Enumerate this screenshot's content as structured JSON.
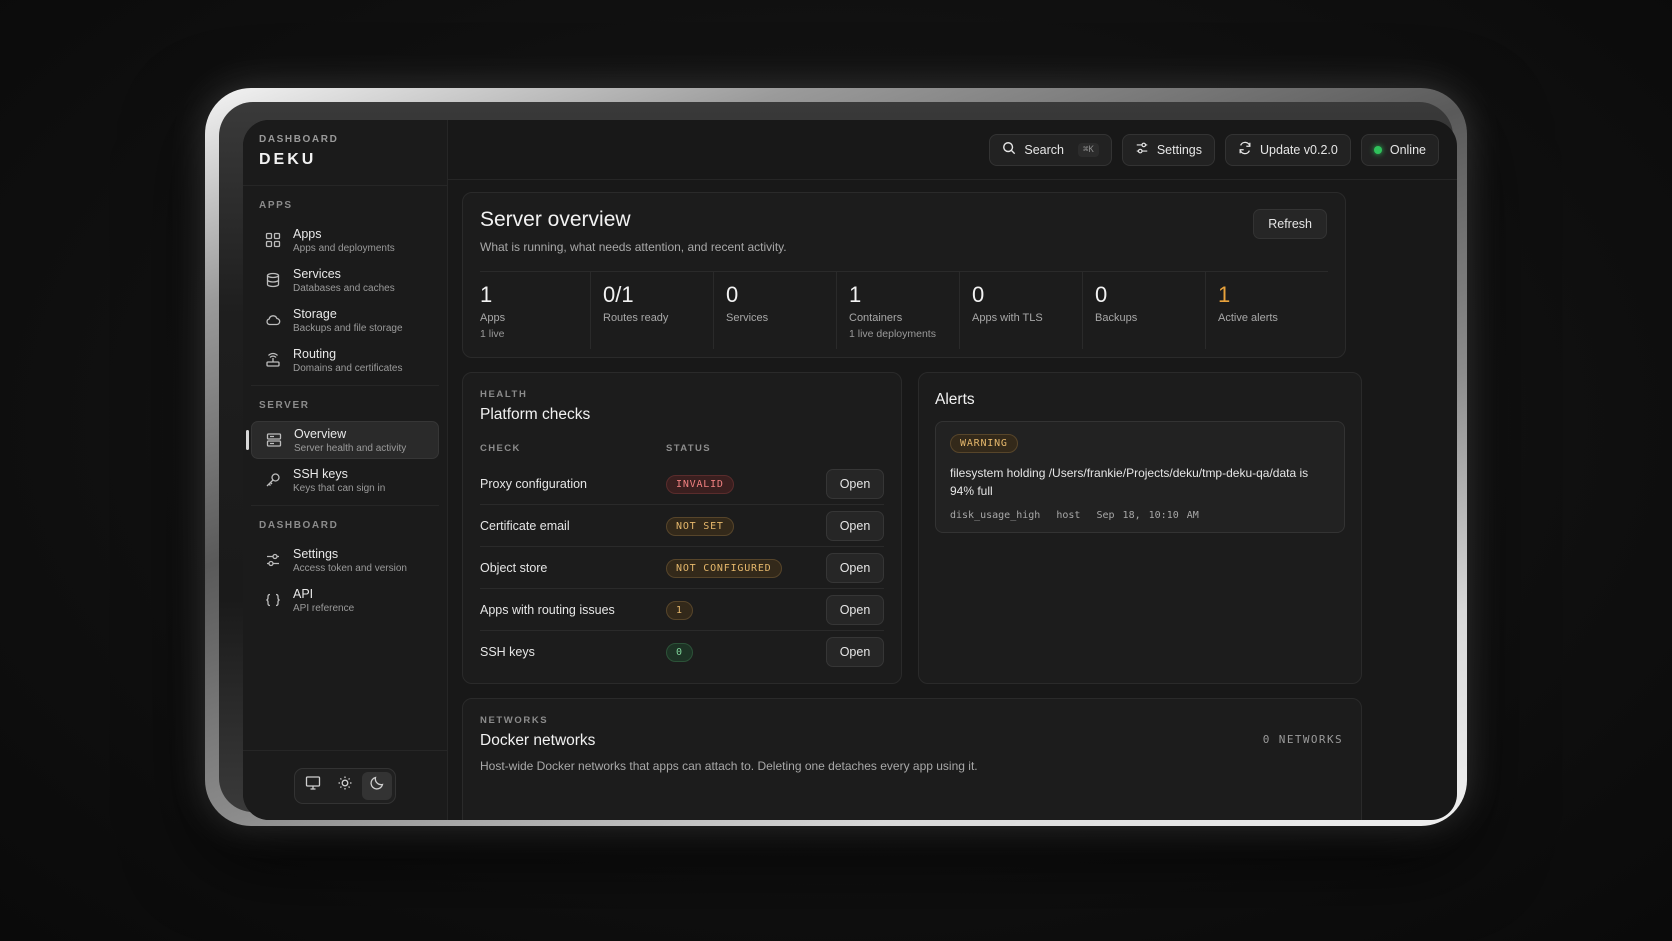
{
  "brand": {
    "kicker": "DASHBOARD",
    "name": "DEKU"
  },
  "sidebar": {
    "sections": [
      {
        "label": "APPS",
        "items": [
          {
            "title": "Apps",
            "subtitle": "Apps and deployments",
            "icon": "grid-icon"
          },
          {
            "title": "Services",
            "subtitle": "Databases and caches",
            "icon": "database-icon"
          },
          {
            "title": "Storage",
            "subtitle": "Backups and file storage",
            "icon": "cloud-icon"
          },
          {
            "title": "Routing",
            "subtitle": "Domains and certificates",
            "icon": "routing-icon"
          }
        ]
      },
      {
        "label": "SERVER",
        "items": [
          {
            "title": "Overview",
            "subtitle": "Server health and activity",
            "icon": "server-icon",
            "active": true
          },
          {
            "title": "SSH keys",
            "subtitle": "Keys that can sign in",
            "icon": "key-icon"
          }
        ]
      },
      {
        "label": "DASHBOARD",
        "items": [
          {
            "title": "Settings",
            "subtitle": "Access token and version",
            "icon": "sliders-icon"
          },
          {
            "title": "API",
            "subtitle": "API reference",
            "icon": "braces-icon"
          }
        ]
      }
    ],
    "theme": {
      "options": [
        "monitor-icon",
        "sun-icon",
        "moon-icon"
      ],
      "active": "moon-icon"
    }
  },
  "topbar": {
    "search_label": "Search",
    "search_shortcut": "⌘K",
    "settings_label": "Settings",
    "update_label": "Update v0.2.0",
    "status_label": "Online",
    "status_color": "#2fc25b"
  },
  "overview": {
    "title": "Server overview",
    "subtitle": "What is running, what needs attention, and recent activity.",
    "refresh_label": "Refresh",
    "stats": [
      {
        "value": "1",
        "label": "Apps",
        "note": "1 live"
      },
      {
        "value": "0/1",
        "label": "Routes ready",
        "note": ""
      },
      {
        "value": "0",
        "label": "Services",
        "note": ""
      },
      {
        "value": "1",
        "label": "Containers",
        "note": "1 live deployments"
      },
      {
        "value": "0",
        "label": "Apps with TLS",
        "note": ""
      },
      {
        "value": "0",
        "label": "Backups",
        "note": ""
      },
      {
        "value": "1",
        "label": "Active alerts",
        "note": "",
        "warn": true
      }
    ]
  },
  "health": {
    "kicker": "HEALTH",
    "title": "Platform checks",
    "col_check": "CHECK",
    "col_status": "STATUS",
    "open_label": "Open",
    "rows": [
      {
        "check": "Proxy configuration",
        "status": "INVALID",
        "tone": "red"
      },
      {
        "check": "Certificate email",
        "status": "NOT SET",
        "tone": "amber"
      },
      {
        "check": "Object store",
        "status": "NOT CONFIGURED",
        "tone": "amber"
      },
      {
        "check": "Apps with routing issues",
        "status": "1",
        "tone": "amber"
      },
      {
        "check": "SSH keys",
        "status": "0",
        "tone": "green"
      }
    ]
  },
  "alerts": {
    "title": "Alerts",
    "items": [
      {
        "level": "WARNING",
        "message": "filesystem holding /Users/frankie/Projects/deku/tmp-deku-qa/data is 94% full",
        "code": "disk_usage_high",
        "source": "host",
        "time": "Sep 18, 10:10 AM"
      }
    ]
  },
  "networks": {
    "kicker": "NETWORKS",
    "title": "Docker networks",
    "subtitle": "Host-wide Docker networks that apps can attach to. Deleting one detaches every app using it.",
    "count": "0 NETWORKS"
  }
}
